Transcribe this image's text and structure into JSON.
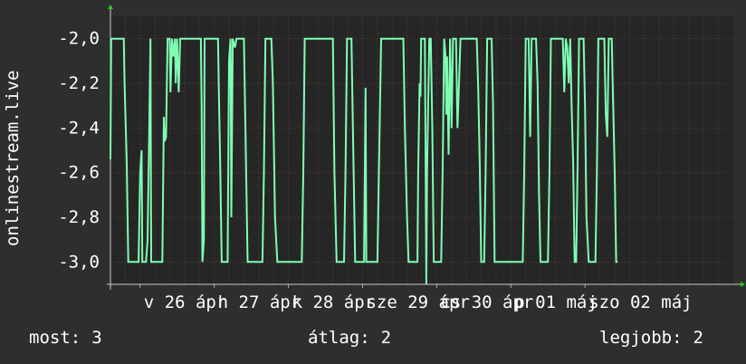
{
  "chart_data": {
    "type": "line",
    "ylabel": "onlinestream.live",
    "ylim": [
      -3.1,
      -1.9
    ],
    "yticks": [
      "-2,0",
      "-2,2",
      "-2,4",
      "-2,6",
      "-2,8",
      "-3,0"
    ],
    "ytick_values": [
      -2.0,
      -2.2,
      -2.4,
      -2.6,
      -2.8,
      -3.0
    ],
    "xlim": [
      0,
      8.4
    ],
    "xticks": [
      {
        "x": 0.4,
        "label": "v 26 ápr"
      },
      {
        "x": 1.4,
        "label": "h 27 ápr"
      },
      {
        "x": 2.4,
        "label": "k 28 ápr"
      },
      {
        "x": 3.4,
        "label": "sze 29 ápr"
      },
      {
        "x": 4.4,
        "label": "cs 30 ápr"
      },
      {
        "x": 5.4,
        "label": "p 01 máj"
      },
      {
        "x": 6.4,
        "label": "szo 02 máj"
      }
    ],
    "grid": true,
    "colors": {
      "line": "#7fffb4",
      "background": "#262626",
      "grid": "#5a3a3a",
      "axis_arrow": "#22cc22"
    },
    "series": [
      {
        "values": [
          [
            0.0,
            -2.54
          ],
          [
            0.01,
            -2.0
          ],
          [
            0.18,
            -2.0
          ],
          [
            0.19,
            -2.2
          ],
          [
            0.22,
            -2.56
          ],
          [
            0.24,
            -3.0
          ],
          [
            0.38,
            -3.0
          ],
          [
            0.4,
            -2.6
          ],
          [
            0.42,
            -2.5
          ],
          [
            0.43,
            -3.0
          ],
          [
            0.48,
            -3.0
          ],
          [
            0.5,
            -2.9
          ],
          [
            0.52,
            -2.48
          ],
          [
            0.54,
            -2.0
          ],
          [
            0.55,
            -3.0
          ],
          [
            0.7,
            -3.0
          ],
          [
            0.72,
            -2.35
          ],
          [
            0.73,
            -2.46
          ],
          [
            0.75,
            -2.44
          ],
          [
            0.77,
            -2.0
          ],
          [
            0.8,
            -2.0
          ],
          [
            0.81,
            -2.24
          ],
          [
            0.83,
            -2.0
          ],
          [
            0.85,
            -2.08
          ],
          [
            0.87,
            -2.0
          ],
          [
            0.88,
            -2.2
          ],
          [
            0.9,
            -2.0
          ],
          [
            0.92,
            -2.24
          ],
          [
            0.94,
            -2.0
          ],
          [
            1.22,
            -2.0
          ],
          [
            1.23,
            -2.3
          ],
          [
            1.24,
            -3.0
          ],
          [
            1.26,
            -2.9
          ],
          [
            1.27,
            -2.0
          ],
          [
            1.45,
            -2.0
          ],
          [
            1.46,
            -2.2
          ],
          [
            1.48,
            -2.56
          ],
          [
            1.5,
            -3.0
          ],
          [
            1.58,
            -3.0
          ],
          [
            1.6,
            -2.1
          ],
          [
            1.62,
            -2.0
          ],
          [
            1.63,
            -2.8
          ],
          [
            1.65,
            -2.0
          ],
          [
            1.68,
            -2.04
          ],
          [
            1.7,
            -2.0
          ],
          [
            1.8,
            -2.0
          ],
          [
            1.82,
            -2.4
          ],
          [
            1.85,
            -3.0
          ],
          [
            2.05,
            -3.0
          ],
          [
            2.07,
            -2.6
          ],
          [
            2.09,
            -2.0
          ],
          [
            2.17,
            -2.0
          ],
          [
            2.19,
            -2.2
          ],
          [
            2.22,
            -2.8
          ],
          [
            2.25,
            -3.0
          ],
          [
            2.58,
            -3.0
          ],
          [
            2.6,
            -2.6
          ],
          [
            2.62,
            -2.0
          ],
          [
            3.0,
            -2.0
          ],
          [
            3.02,
            -2.6
          ],
          [
            3.05,
            -3.0
          ],
          [
            3.15,
            -3.0
          ],
          [
            3.17,
            -2.6
          ],
          [
            3.19,
            -2.0
          ],
          [
            3.25,
            -2.0
          ],
          [
            3.27,
            -2.4
          ],
          [
            3.3,
            -3.0
          ],
          [
            3.42,
            -3.0
          ],
          [
            3.44,
            -2.22
          ],
          [
            3.45,
            -3.0
          ],
          [
            3.6,
            -3.0
          ],
          [
            3.62,
            -2.6
          ],
          [
            3.65,
            -2.0
          ],
          [
            3.95,
            -2.0
          ],
          [
            3.97,
            -2.4
          ],
          [
            4.0,
            -2.8
          ],
          [
            4.02,
            -3.0
          ],
          [
            4.14,
            -3.0
          ],
          [
            4.15,
            -2.6
          ],
          [
            4.17,
            -2.2
          ],
          [
            4.18,
            -2.26
          ],
          [
            4.19,
            -2.0
          ],
          [
            4.24,
            -2.0
          ],
          [
            4.26,
            -3.1
          ],
          [
            4.27,
            -2.6
          ],
          [
            4.3,
            -2.0
          ],
          [
            4.32,
            -2.0
          ],
          [
            4.34,
            -2.4
          ],
          [
            4.36,
            -3.0
          ],
          [
            4.46,
            -3.0
          ],
          [
            4.48,
            -2.6
          ],
          [
            4.5,
            -2.0
          ],
          [
            4.52,
            -2.08
          ],
          [
            4.53,
            -2.34
          ],
          [
            4.54,
            -2.08
          ],
          [
            4.56,
            -2.52
          ],
          [
            4.58,
            -2.0
          ],
          [
            4.6,
            -2.4
          ],
          [
            4.62,
            -2.0
          ],
          [
            4.66,
            -2.0
          ],
          [
            4.68,
            -2.4
          ],
          [
            4.7,
            -2.2
          ],
          [
            4.72,
            -2.0
          ],
          [
            4.94,
            -2.0
          ],
          [
            4.96,
            -2.22
          ],
          [
            4.98,
            -2.56
          ],
          [
            5.0,
            -3.0
          ],
          [
            5.04,
            -3.0
          ],
          [
            5.06,
            -2.6
          ],
          [
            5.08,
            -2.0
          ],
          [
            5.14,
            -2.0
          ],
          [
            5.16,
            -2.3
          ],
          [
            5.18,
            -3.0
          ],
          [
            5.56,
            -3.0
          ],
          [
            5.58,
            -2.6
          ],
          [
            5.6,
            -2.0
          ],
          [
            5.64,
            -2.0
          ],
          [
            5.66,
            -2.44
          ],
          [
            5.68,
            -2.0
          ],
          [
            5.74,
            -2.0
          ],
          [
            5.76,
            -2.2
          ],
          [
            5.78,
            -2.7
          ],
          [
            5.8,
            -3.0
          ],
          [
            5.9,
            -3.0
          ],
          [
            5.92,
            -2.6
          ],
          [
            5.94,
            -2.0
          ],
          [
            6.1,
            -2.0
          ],
          [
            6.12,
            -2.24
          ],
          [
            6.14,
            -2.0
          ],
          [
            6.16,
            -2.04
          ],
          [
            6.18,
            -2.2
          ],
          [
            6.2,
            -2.0
          ],
          [
            6.22,
            -2.3
          ],
          [
            6.24,
            -2.56
          ],
          [
            6.26,
            -3.0
          ],
          [
            6.28,
            -3.0
          ],
          [
            6.3,
            -2.56
          ],
          [
            6.32,
            -2.0
          ],
          [
            6.38,
            -2.0
          ],
          [
            6.4,
            -2.3
          ],
          [
            6.42,
            -2.8
          ],
          [
            6.45,
            -3.0
          ],
          [
            6.54,
            -3.0
          ],
          [
            6.56,
            -2.6
          ],
          [
            6.58,
            -2.0
          ],
          [
            6.66,
            -2.0
          ],
          [
            6.68,
            -2.34
          ],
          [
            6.7,
            -2.44
          ],
          [
            6.72,
            -2.0
          ],
          [
            6.76,
            -2.0
          ],
          [
            6.78,
            -2.3
          ],
          [
            6.8,
            -2.6
          ],
          [
            6.82,
            -3.0
          ],
          [
            6.84,
            -3.0
          ]
        ]
      }
    ]
  },
  "footer": {
    "current_label": "most:",
    "current_value": "3",
    "average_label": "átlag:",
    "average_value": "2",
    "best_label": "legjobb:",
    "best_value": "2"
  }
}
